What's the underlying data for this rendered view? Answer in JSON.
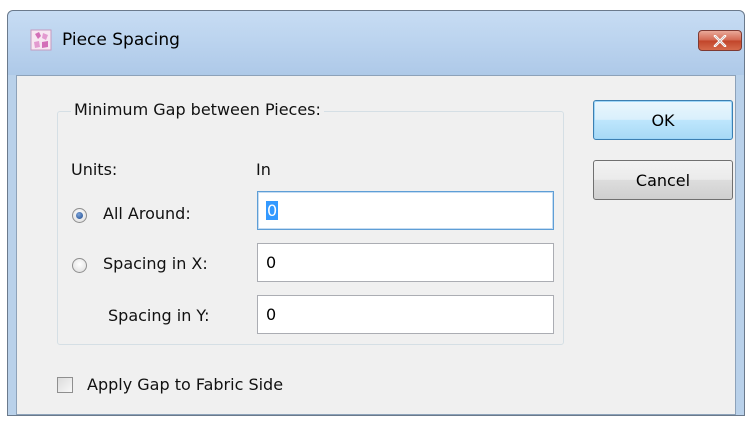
{
  "window": {
    "title": "Piece Spacing",
    "icon": "pattern-app-icon",
    "close_icon": "close-icon"
  },
  "group": {
    "title": "Minimum Gap between Pieces:",
    "units_label": "Units:",
    "units_value": "In",
    "all_around": {
      "label": "All Around:",
      "value": "0",
      "selected": true
    },
    "spacing_x": {
      "label": "Spacing in X:",
      "value": "0",
      "selected": false
    },
    "spacing_y": {
      "label": "Spacing in Y:",
      "value": "0"
    }
  },
  "checkbox": {
    "label": "Apply Gap to Fabric Side",
    "checked": false
  },
  "buttons": {
    "ok": "OK",
    "cancel": "Cancel"
  },
  "colors": {
    "title_bar": "#bcd4ef",
    "client": "#f0f0f0",
    "close": "#c14429",
    "selection": "#3399ff"
  }
}
